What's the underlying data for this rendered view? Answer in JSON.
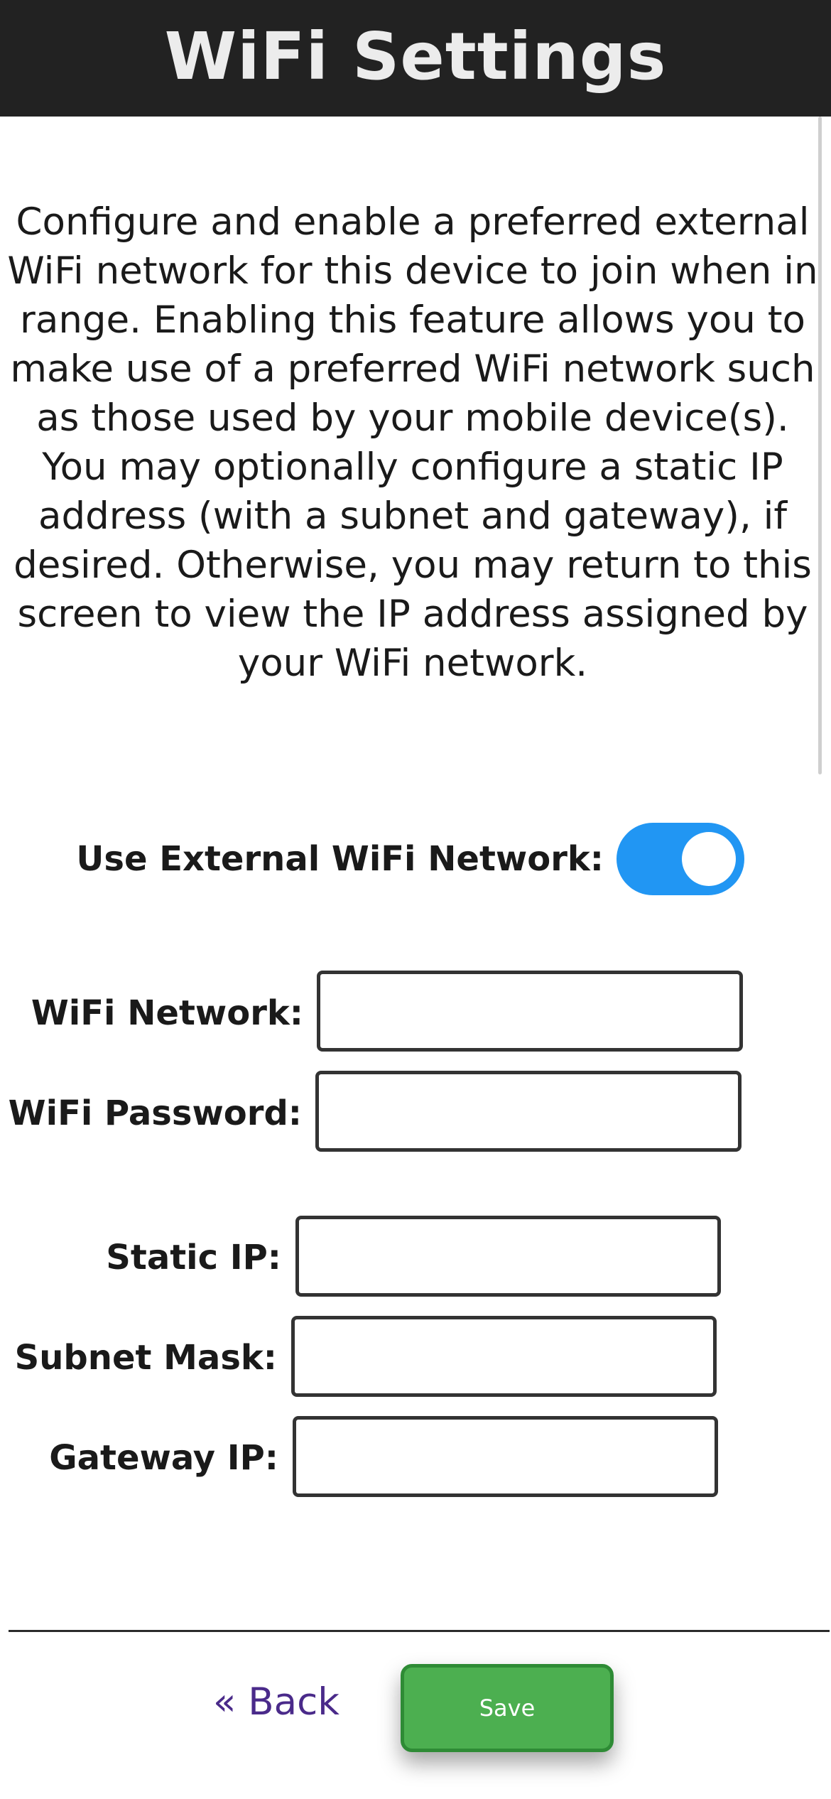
{
  "header": {
    "title": "WiFi Settings"
  },
  "description": "Configure and enable a preferred external WiFi network for this device to join when in range. Enabling this feature allows you to make use of a preferred WiFi network such as those used by your mobile device(s). You may optionally configure a static IP address (with a subnet and gateway), if desired. Otherwise, you may return to this screen to view the IP address assigned by your WiFi network.",
  "toggle": {
    "label": "Use External WiFi Network:",
    "enabled": true,
    "on_color": "#2196f3"
  },
  "fields": {
    "wifi_network": {
      "label": "WiFi Network:",
      "value": ""
    },
    "wifi_password": {
      "label": "WiFi Password:",
      "value": ""
    },
    "static_ip": {
      "label": "Static IP:",
      "value": ""
    },
    "subnet_mask": {
      "label": "Subnet Mask:",
      "value": ""
    },
    "gateway_ip": {
      "label": "Gateway IP:",
      "value": ""
    }
  },
  "footer": {
    "back_label": "« Back",
    "save_label": "Save",
    "save_color": "#4caf50",
    "back_color": "#4a2a8a"
  }
}
